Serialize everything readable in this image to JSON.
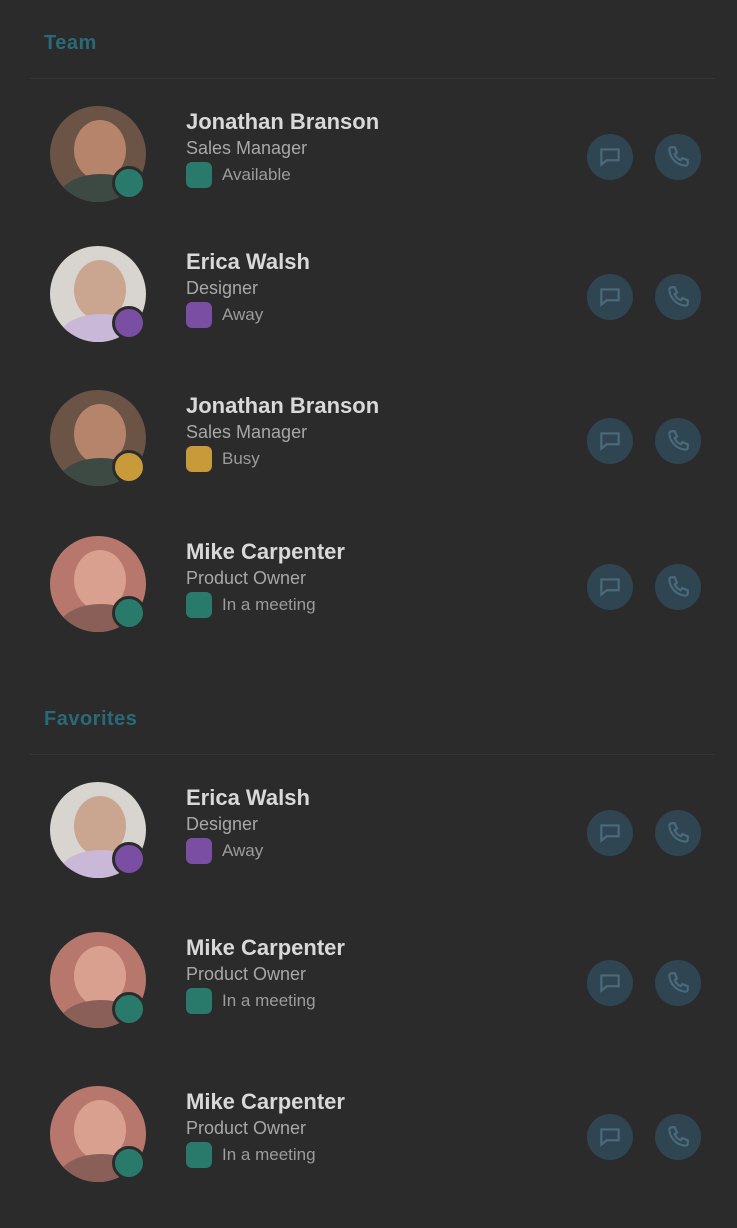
{
  "sections": [
    {
      "header": "Team",
      "contacts": [
        {
          "name": "Jonathan Branson",
          "title": "Sales Manager",
          "status": "Available",
          "status_color": "#2a7a6c",
          "avatar": {
            "bg": "#6b5446",
            "face": "#b5846a",
            "shoulder": "#3d4a44"
          },
          "actions": [
            "chat-icon",
            "call-icon"
          ]
        },
        {
          "name": "Erica Walsh",
          "title": "Designer",
          "status": "Away",
          "status_color": "#7a4fa3",
          "avatar": {
            "bg": "#d8d4cf",
            "face": "#caa58f",
            "shoulder": "#c9b8d8"
          },
          "actions": [
            "chat-icon",
            "call-icon"
          ]
        },
        {
          "name": "Jonathan Branson",
          "title": "Sales Manager",
          "status": "Busy",
          "status_color": "#c99a3a",
          "avatar": {
            "bg": "#6b5446",
            "face": "#b5846a",
            "shoulder": "#3d4a44"
          },
          "actions": [
            "chat-icon",
            "call-icon"
          ]
        },
        {
          "name": "Mike Carpenter",
          "title": "Product Owner",
          "status": "In a meeting",
          "status_color": "#2a7a6c",
          "avatar": {
            "bg": "#b7776c",
            "face": "#d9a08f",
            "shoulder": "#8a5f58"
          },
          "actions": [
            "chat-icon",
            "call-icon"
          ]
        }
      ]
    },
    {
      "header": "Favorites",
      "contacts": [
        {
          "name": "Erica Walsh",
          "title": "Designer",
          "status": "Away",
          "status_color": "#7a4fa3",
          "avatar": {
            "bg": "#d8d4cf",
            "face": "#caa58f",
            "shoulder": "#c9b8d8"
          },
          "actions": [
            "chat-icon",
            "call-icon"
          ]
        },
        {
          "name": "Mike Carpenter",
          "title": "Product Owner",
          "status": "In a meeting",
          "status_color": "#2a7a6c",
          "avatar": {
            "bg": "#b7776c",
            "face": "#d9a08f",
            "shoulder": "#8a5f58"
          },
          "actions": [
            "chat-icon",
            "call-icon"
          ]
        },
        {
          "name": "Mike Carpenter",
          "title": "Product Owner",
          "status": "In a meeting",
          "status_color": "#2a7a6c",
          "avatar": {
            "bg": "#b7776c",
            "face": "#d9a08f",
            "shoulder": "#8a5f58"
          },
          "actions": [
            "chat-icon",
            "call-icon"
          ]
        }
      ]
    }
  ]
}
